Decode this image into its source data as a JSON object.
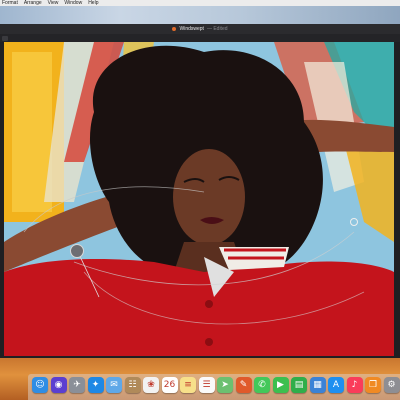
{
  "menubar": {
    "items": [
      "Format",
      "Arrange",
      "View",
      "Window",
      "Help"
    ]
  },
  "window": {
    "title": "Windswept",
    "edited_label": "— Edited"
  },
  "dock": {
    "icons": [
      {
        "name": "finder-icon",
        "color": "#2f8de4",
        "glyph": "☺"
      },
      {
        "name": "siri-icon",
        "color": "#5b3fd1",
        "glyph": "◉"
      },
      {
        "name": "launchpad-icon",
        "color": "#8a8f98",
        "glyph": "✈"
      },
      {
        "name": "safari-icon",
        "color": "#1e88e5",
        "glyph": "✦"
      },
      {
        "name": "mail-icon",
        "color": "#5fa8e8",
        "glyph": "✉"
      },
      {
        "name": "contacts-icon",
        "color": "#b08a5a",
        "glyph": "☷"
      },
      {
        "name": "photos-icon",
        "color": "#f2f2f2",
        "glyph": "❀"
      },
      {
        "name": "calendar-icon",
        "color": "#ffffff",
        "glyph": "26"
      },
      {
        "name": "notes-icon",
        "color": "#f7e08a",
        "glyph": "≡"
      },
      {
        "name": "reminders-icon",
        "color": "#fafafa",
        "glyph": "☰"
      },
      {
        "name": "maps-icon",
        "color": "#6cc070",
        "glyph": "➤"
      },
      {
        "name": "photo-editor-icon",
        "color": "#e05a2b",
        "glyph": "✎"
      },
      {
        "name": "messages-icon",
        "color": "#43c85a",
        "glyph": "✆"
      },
      {
        "name": "facetime-icon",
        "color": "#3cbf4f",
        "glyph": "▶"
      },
      {
        "name": "numbers-icon",
        "color": "#2fae4a",
        "glyph": "▤"
      },
      {
        "name": "keynote-icon",
        "color": "#3b82d6",
        "glyph": "▦"
      },
      {
        "name": "app-store-icon",
        "color": "#1e8ff0",
        "glyph": "A"
      },
      {
        "name": "music-icon",
        "color": "#fa3c5a",
        "glyph": "♪"
      },
      {
        "name": "books-icon",
        "color": "#f08a24",
        "glyph": "❐"
      },
      {
        "name": "system-preferences-icon",
        "color": "#8e8e93",
        "glyph": "⚙"
      }
    ]
  }
}
